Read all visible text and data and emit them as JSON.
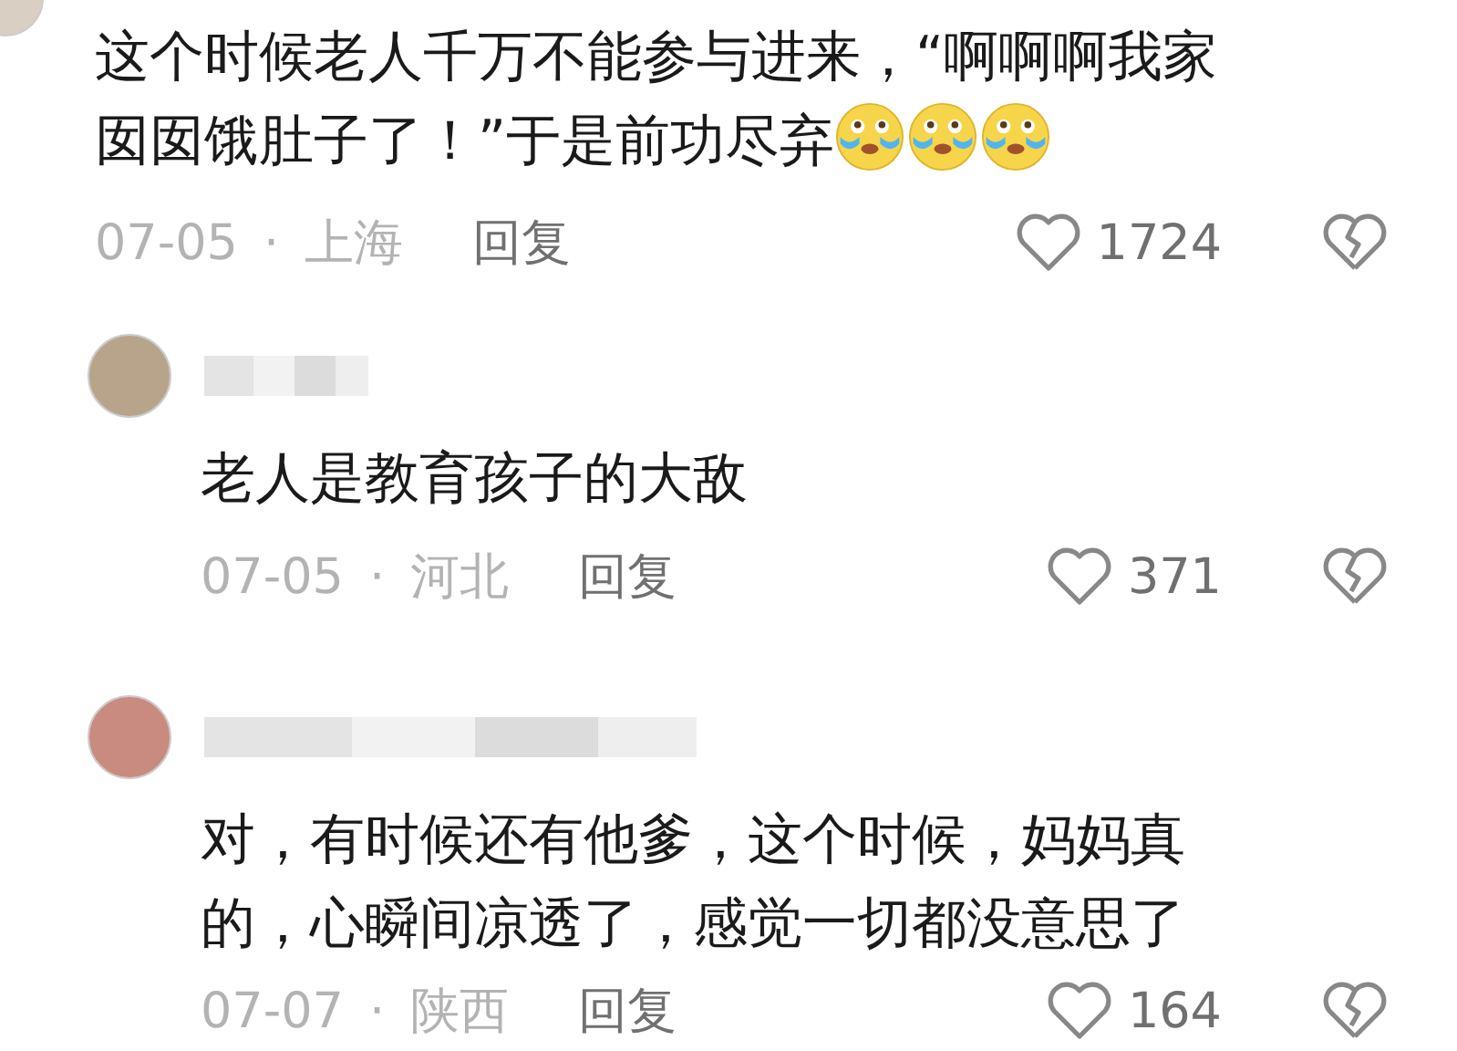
{
  "comment": {
    "text_lines": [
      "这个时候老人千万不能参与进来，“啊啊啊我家",
      "囡囡饿肚子了！”于是前功尽弃"
    ],
    "emojis": [
      {
        "kind": "crying"
      },
      {
        "kind": "crying"
      },
      {
        "kind": "crying"
      }
    ],
    "date": "07-05",
    "separator": "·",
    "location": "上海",
    "reply_label": "回复",
    "likes": "1724"
  },
  "replies": [
    {
      "text": "老人是教育孩子的大敌",
      "date": "07-05",
      "separator": "·",
      "location": "河北",
      "reply_label": "回复",
      "likes": "371"
    },
    {
      "text": "对，有时候还有他爹，这个时候，妈妈真的，心瞬间凉透了，感觉一切都没意思了",
      "date": "07-07",
      "separator": "·",
      "location": "陕西",
      "reply_label": "回复",
      "likes": "164"
    }
  ]
}
